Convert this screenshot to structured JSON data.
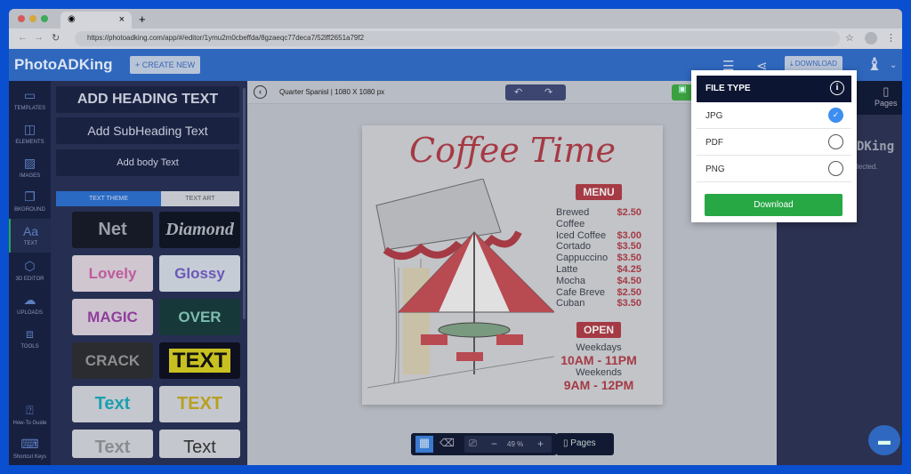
{
  "browser": {
    "url": "https://photoadking.com/app/#/editor/1ymu2m0cbeffda/8gzaeqc77deca7/52lff2651a79f2",
    "tab_close": "×",
    "new_tab": "+"
  },
  "header": {
    "logo": "PhotoADKing",
    "create_new": "+ CREATE NEW",
    "download": "DOWNLOAD"
  },
  "sidebar": {
    "items": [
      {
        "label": "TEMPLATES",
        "icon": "template-icon"
      },
      {
        "label": "ELEMENTS",
        "icon": "elements-icon"
      },
      {
        "label": "IMAGES",
        "icon": "image-icon"
      },
      {
        "label": "BKGROUND",
        "icon": "background-icon"
      },
      {
        "label": "TEXT",
        "icon": "text-icon",
        "active": true
      },
      {
        "label": "3D EDITOR",
        "icon": "cube-icon"
      },
      {
        "label": "UPLOADS",
        "icon": "upload-icon"
      },
      {
        "label": "TOOLS",
        "icon": "toolbox-icon"
      }
    ],
    "bottom": [
      {
        "label": "How-To Guide"
      },
      {
        "label": "Shortcut Keys"
      }
    ]
  },
  "text_panel": {
    "heading": "ADD HEADING TEXT",
    "subheading": "Add SubHeading Text",
    "body": "Add body Text",
    "tabs": [
      "TEXT THEME",
      "TEXT ART"
    ],
    "active_tab": "TEXT THEME",
    "themes": [
      "Net",
      "Diamond",
      "Lovely",
      "Glossy",
      "MAGIC",
      "OVER",
      "CRACK",
      "TEXT",
      "Text",
      "TEXT",
      "Text",
      "Text"
    ]
  },
  "canvas": {
    "title": "Quarter Spanisl | 1080 X 1080 px",
    "zoom": "49 %",
    "pages_label": "Pages"
  },
  "poster": {
    "title": "Coffee Time",
    "menu_label": "MENU",
    "items": [
      {
        "name": "Brewed Coffee",
        "price": "$2.50"
      },
      {
        "name": "Iced Coffee",
        "price": "$3.00"
      },
      {
        "name": "Cortado",
        "price": "$3.50"
      },
      {
        "name": "Cappuccino",
        "price": "$3.50"
      },
      {
        "name": "Latte",
        "price": "$4.25"
      },
      {
        "name": "Mocha",
        "price": "$4.50"
      },
      {
        "name": "Cafe Breve",
        "price": "$2.50"
      },
      {
        "name": "Cuban",
        "price": "$3.50"
      }
    ],
    "open_label": "OPEN",
    "weekdays": "Weekdays",
    "weekday_hours": "10AM - 11PM",
    "weekends": "Weekends",
    "weekend_hours": "9AM - 12PM"
  },
  "right_panel": {
    "pages_tab": "Pages",
    "brand_fragment": "DKing",
    "note_fragment": "lected."
  },
  "popup": {
    "title": "FILE TYPE",
    "options": [
      {
        "label": "JPG",
        "selected": true
      },
      {
        "label": "PDF",
        "selected": false
      },
      {
        "label": "PNG",
        "selected": false
      }
    ],
    "download_button": "Download",
    "check": "✓"
  },
  "colors": {
    "accent": "#3c8ef0",
    "download_green": "#28a745",
    "poster_red": "#a53a44"
  }
}
